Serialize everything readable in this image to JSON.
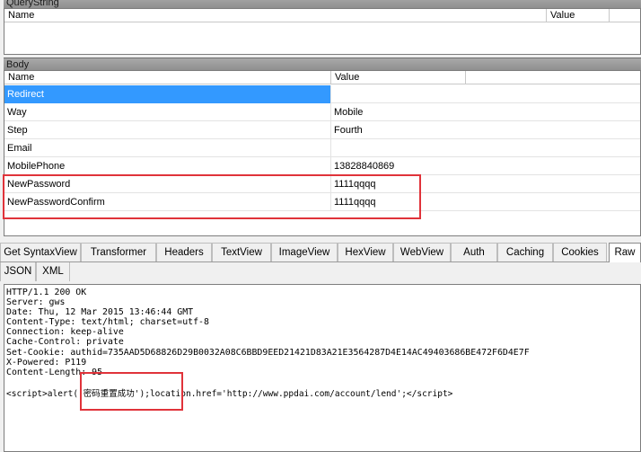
{
  "querystring": {
    "title": "QueryString",
    "columns": [
      "Name",
      "Value"
    ]
  },
  "body": {
    "title": "Body",
    "columns": [
      "Name",
      "Value"
    ],
    "rows": [
      {
        "name": "Redirect",
        "value": ""
      },
      {
        "name": "Way",
        "value": "Mobile"
      },
      {
        "name": "Step",
        "value": "Fourth"
      },
      {
        "name": "Email",
        "value": ""
      },
      {
        "name": "MobilePhone",
        "value": "13828840869"
      },
      {
        "name": "NewPassword",
        "value": "1111qqqq"
      },
      {
        "name": "NewPasswordConfirm",
        "value": "1111qqqq"
      }
    ]
  },
  "tabs": [
    "Get SyntaxView",
    "Transformer",
    "Headers",
    "TextView",
    "ImageView",
    "HexView",
    "WebView",
    "Auth",
    "Caching",
    "Cookies",
    "Raw"
  ],
  "subtabs": [
    "JSON",
    "XML"
  ],
  "raw": {
    "lines": [
      "HTTP/1.1 200 OK",
      "Server: gws",
      "Date: Thu, 12 Mar 2015 13:46:44 GMT",
      "Content-Type: text/html; charset=utf-8",
      "Connection: keep-alive",
      "Cache-Control: private",
      "Set-Cookie: authid=735AAD5D68826D29B0032A08C6BBD9EED21421D83A21E3564287D4E14AC49403686BE472F6D4E7F",
      "X-Powered: P119",
      "Content-Length: 95"
    ],
    "script": "<script>alert('密码重置成功');location.href='http://www.ppdai.com/account/lend';</script>"
  },
  "colors": {
    "selected": "#3399ff",
    "highlight": "#e0333a"
  }
}
